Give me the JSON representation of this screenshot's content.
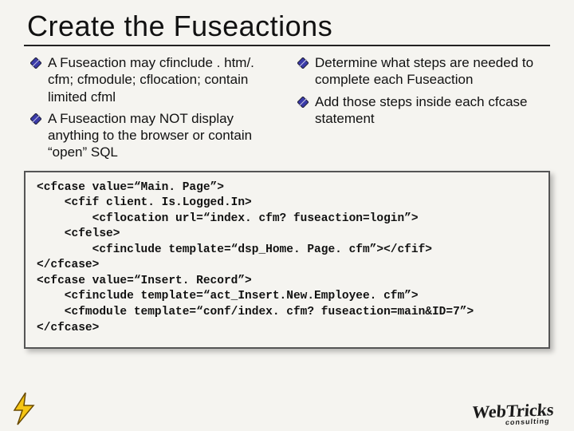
{
  "title": "Create the Fuseactions",
  "left_bullets": [
    "A Fuseaction may cfinclude . htm/. cfm; cfmodule; cflocation; contain limited cfml",
    "A Fuseaction may NOT display anything to the browser or contain “open” SQL"
  ],
  "right_bullets": [
    "Determine what steps are needed to complete each Fuseaction",
    "Add those steps inside each cfcase statement"
  ],
  "code": "<cfcase value=“Main. Page”>\n    <cfif client. Is.Logged.In>\n        <cflocation url=“index. cfm? fuseaction=login”>\n    <cfelse>\n        <cfinclude template=“dsp_Home. Page. cfm”></cfif>\n</cfcase>\n<cfcase value=“Insert. Record”>\n    <cfinclude template=“act_Insert.New.Employee. cfm”>\n    <cfmodule template=“conf/index. cfm? fuseaction=main&ID=7”>\n</cfcase>",
  "brand": "WebTricks",
  "brand_sub": "consulting"
}
